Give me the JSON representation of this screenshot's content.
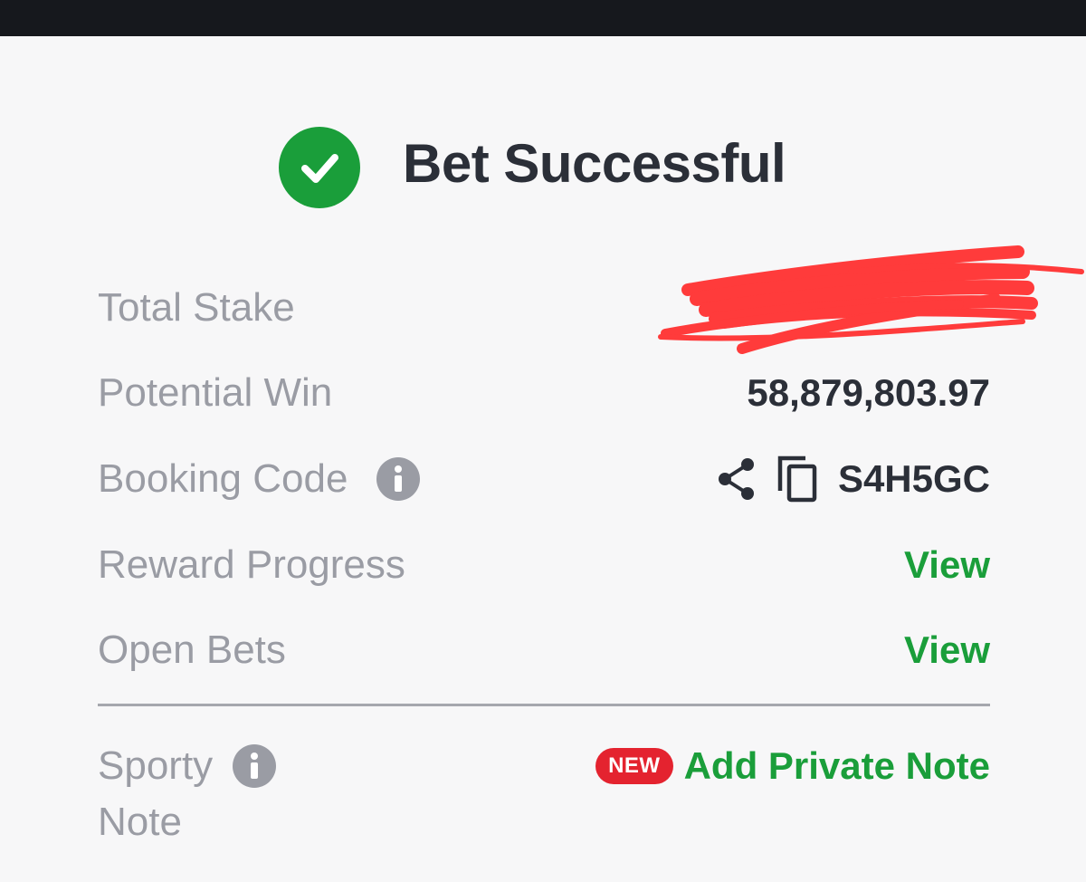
{
  "status": {
    "title": "Bet Successful"
  },
  "rows": [
    {
      "label": "Total Stake",
      "value": ""
    },
    {
      "label": "Potential Win",
      "value": "58,879,803.97"
    },
    {
      "label": "Booking Code",
      "value": "S4H5GC"
    },
    {
      "label": "Reward Progress",
      "value": "View"
    },
    {
      "label": "Open Bets",
      "value": "View"
    }
  ],
  "note": {
    "label_line1": "Sporty",
    "label_line2": "Note",
    "badge": "NEW",
    "action": "Add Private Note"
  },
  "colors": {
    "accent_green": "#1a9e3a",
    "badge_red": "#e4232f",
    "scribble_red": "#ff3b3b"
  },
  "icons": [
    "check-circle-icon",
    "info-icon",
    "share-icon",
    "copy-icon"
  ]
}
